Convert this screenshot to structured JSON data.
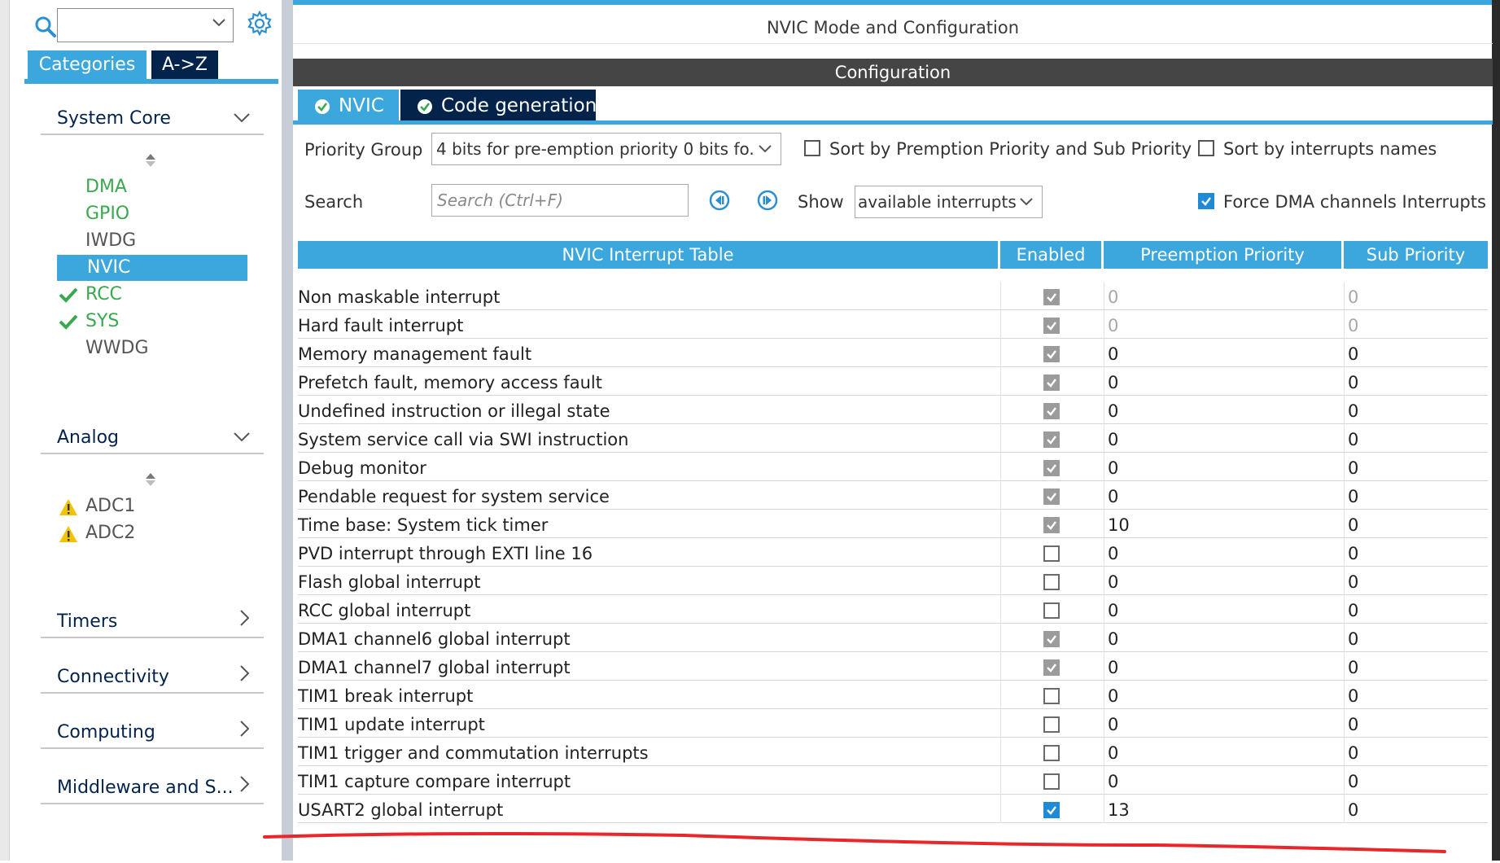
{
  "left_panel": {
    "search_value": "",
    "tabs": {
      "categories": "Categories",
      "az": "A->Z"
    },
    "groups": [
      {
        "label": "System Core",
        "expanded": true,
        "items": [
          {
            "label": "DMA",
            "state": "green"
          },
          {
            "label": "GPIO",
            "state": "green"
          },
          {
            "label": "IWDG",
            "state": "grey"
          },
          {
            "label": "NVIC",
            "state": "selected"
          },
          {
            "label": "RCC",
            "state": "checked"
          },
          {
            "label": "SYS",
            "state": "checked"
          },
          {
            "label": "WWDG",
            "state": "grey"
          }
        ]
      },
      {
        "label": "Analog",
        "expanded": true,
        "items": [
          {
            "label": "ADC1",
            "state": "warning"
          },
          {
            "label": "ADC2",
            "state": "warning"
          }
        ]
      },
      {
        "label": "Timers",
        "expanded": false
      },
      {
        "label": "Connectivity",
        "expanded": false
      },
      {
        "label": "Computing",
        "expanded": false
      },
      {
        "label": "Middleware and S...",
        "expanded": false
      }
    ]
  },
  "header": {
    "title": "NVIC Mode and Configuration",
    "config_bar": "Configuration",
    "tabs": [
      {
        "label": "NVIC"
      },
      {
        "label": "Code generation"
      }
    ]
  },
  "controls": {
    "priority_group_label": "Priority Group",
    "priority_group_value": "4 bits for pre-emption priority 0 bits fo..",
    "sort_priority_label": "Sort by Premption Priority and Sub Priority",
    "sort_priority_checked": false,
    "sort_names_label": "Sort by interrupts names",
    "sort_names_checked": false,
    "search_label": "Search",
    "search_placeholder": "Search (Ctrl+F)",
    "show_label": "Show",
    "show_value": "available interrupts",
    "force_dma_label": "Force DMA channels Interrupts",
    "force_dma_checked": true
  },
  "table": {
    "headers": {
      "name": "NVIC Interrupt Table",
      "enabled": "Enabled",
      "preemption": "Preemption Priority",
      "sub": "Sub Priority"
    },
    "rows": [
      {
        "name": "Non maskable interrupt",
        "enabled": true,
        "locked": true,
        "preemption": "0",
        "sub": "0",
        "greyed": true
      },
      {
        "name": "Hard fault interrupt",
        "enabled": true,
        "locked": true,
        "preemption": "0",
        "sub": "0",
        "greyed": true
      },
      {
        "name": "Memory management fault",
        "enabled": true,
        "locked": true,
        "preemption": "0",
        "sub": "0",
        "greyed": false
      },
      {
        "name": "Prefetch fault, memory access fault",
        "enabled": true,
        "locked": true,
        "preemption": "0",
        "sub": "0",
        "greyed": false
      },
      {
        "name": "Undefined instruction or illegal state",
        "enabled": true,
        "locked": true,
        "preemption": "0",
        "sub": "0",
        "greyed": false
      },
      {
        "name": "System service call via SWI instruction",
        "enabled": true,
        "locked": true,
        "preemption": "0",
        "sub": "0",
        "greyed": false
      },
      {
        "name": "Debug monitor",
        "enabled": true,
        "locked": true,
        "preemption": "0",
        "sub": "0",
        "greyed": false
      },
      {
        "name": "Pendable request for system service",
        "enabled": true,
        "locked": true,
        "preemption": "0",
        "sub": "0",
        "greyed": false
      },
      {
        "name": "Time base: System tick timer",
        "enabled": true,
        "locked": true,
        "preemption": "10",
        "sub": "0",
        "greyed": false
      },
      {
        "name": "PVD interrupt through EXTI line 16",
        "enabled": false,
        "locked": false,
        "preemption": "0",
        "sub": "0",
        "greyed": false
      },
      {
        "name": "Flash global interrupt",
        "enabled": false,
        "locked": false,
        "preemption": "0",
        "sub": "0",
        "greyed": false
      },
      {
        "name": "RCC global interrupt",
        "enabled": false,
        "locked": false,
        "preemption": "0",
        "sub": "0",
        "greyed": false
      },
      {
        "name": "DMA1 channel6 global interrupt",
        "enabled": true,
        "locked": true,
        "preemption": "0",
        "sub": "0",
        "greyed": false
      },
      {
        "name": "DMA1 channel7 global interrupt",
        "enabled": true,
        "locked": true,
        "preemption": "0",
        "sub": "0",
        "greyed": false
      },
      {
        "name": "TIM1 break interrupt",
        "enabled": false,
        "locked": false,
        "preemption": "0",
        "sub": "0",
        "greyed": false
      },
      {
        "name": "TIM1 update interrupt",
        "enabled": false,
        "locked": false,
        "preemption": "0",
        "sub": "0",
        "greyed": false
      },
      {
        "name": "TIM1 trigger and commutation interrupts",
        "enabled": false,
        "locked": false,
        "preemption": "0",
        "sub": "0",
        "greyed": false
      },
      {
        "name": "TIM1 capture compare interrupt",
        "enabled": false,
        "locked": false,
        "preemption": "0",
        "sub": "0",
        "greyed": false
      },
      {
        "name": "USART2 global interrupt",
        "enabled": true,
        "locked": false,
        "preemption": "13",
        "sub": "0",
        "greyed": false
      }
    ]
  },
  "colors": {
    "accent_blue": "#3ca7dc",
    "navy": "#03234b",
    "ok_green": "#3aa850",
    "warning_yellow": "#f2c300",
    "annotation_red": "#e8262b"
  }
}
